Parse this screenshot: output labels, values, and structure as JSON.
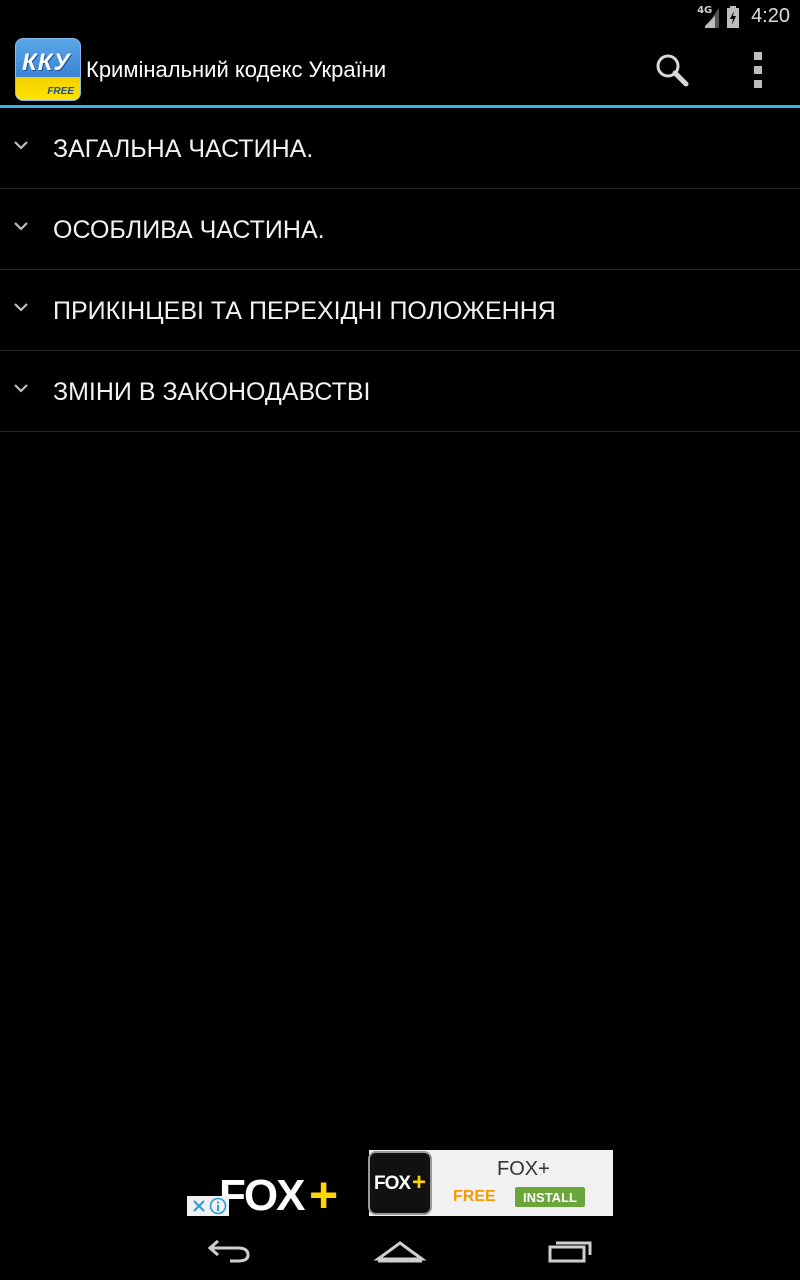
{
  "status_bar": {
    "network": "4G",
    "time": "4:20"
  },
  "action_bar": {
    "app_icon_text": "ККУ",
    "app_icon_badge": "FREE",
    "title": "Кримінальний кодекс України",
    "search_icon": "search-icon",
    "overflow_icon": "overflow-menu-icon"
  },
  "sections": [
    {
      "label": "ЗАГАЛЬНА ЧАСТИНА."
    },
    {
      "label": "ОСОБЛИВА ЧАСТИНА."
    },
    {
      "label": "ПРИКІНЦЕВІ ТА ПЕРЕХІДНІ ПОЛОЖЕННЯ"
    },
    {
      "label": "ЗМІНИ В ЗАКОНОДАВСТВІ"
    }
  ],
  "ad": {
    "brand": "FOX",
    "plus": "+",
    "icon_brand": "FOX",
    "icon_plus": "+",
    "title": "FOX+",
    "free_label": "FREE",
    "install_label": "INSTALL"
  },
  "colors": {
    "accent": "#33b5e5",
    "background": "#000000",
    "ad_free": "#f59a00",
    "ad_install": "#6aa63a",
    "fox_yellow": "#ffd400"
  }
}
